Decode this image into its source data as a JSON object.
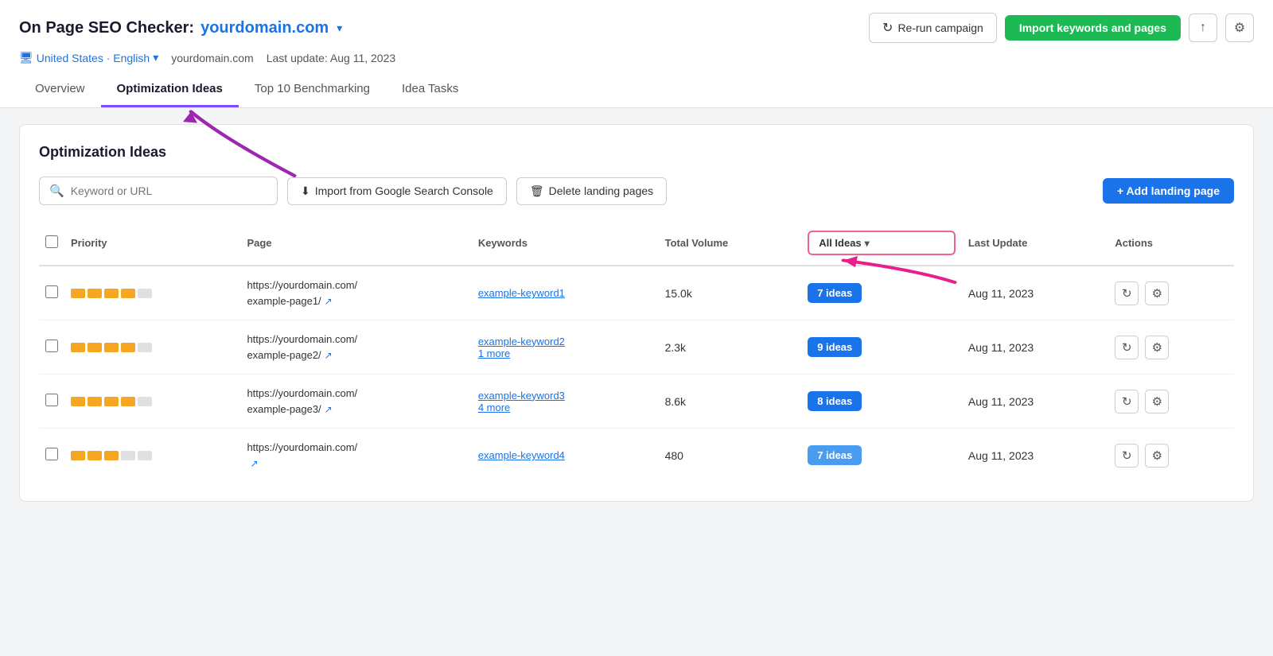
{
  "header": {
    "title_prefix": "On Page SEO Checker:",
    "domain": "yourdomain.com",
    "region": "United States · English",
    "domain_text": "yourdomain.com",
    "last_update": "Last update: Aug 11, 2023",
    "btn_rerun": "Re-run campaign",
    "btn_import": "Import keywords and pages"
  },
  "tabs": [
    {
      "id": "overview",
      "label": "Overview",
      "active": false
    },
    {
      "id": "optimization-ideas",
      "label": "Optimization Ideas",
      "active": true
    },
    {
      "id": "top10",
      "label": "Top 10 Benchmarking",
      "active": false
    },
    {
      "id": "idea-tasks",
      "label": "Idea Tasks",
      "active": false
    }
  ],
  "section": {
    "title": "Optimization Ideas",
    "search_placeholder": "Keyword or URL",
    "btn_gsc": "Import from Google Search Console",
    "btn_delete": "Delete landing pages",
    "btn_add": "+ Add landing page"
  },
  "table": {
    "columns": [
      "",
      "Priority",
      "Page",
      "Keywords",
      "Total Volume",
      "All Ideas",
      "Last Update",
      "Actions"
    ],
    "all_ideas_dropdown": "All Ideas",
    "rows": [
      {
        "priority_filled": 4,
        "priority_total": 5,
        "page": "https://yourdomain.com/\nexample-page1/",
        "keyword": "example-keyword1",
        "keyword_more": null,
        "volume": "15.0k",
        "ideas": "7 ideas",
        "ideas_color": "blue",
        "last_update": "Aug 11, 2023"
      },
      {
        "priority_filled": 4,
        "priority_total": 5,
        "page": "https://yourdomain.com/\nexample-page2/",
        "keyword": "example-keyword2",
        "keyword_more": "1 more",
        "volume": "2.3k",
        "ideas": "9 ideas",
        "ideas_color": "blue",
        "last_update": "Aug 11, 2023"
      },
      {
        "priority_filled": 4,
        "priority_total": 5,
        "page": "https://yourdomain.com/\nexample-page3/",
        "keyword": "example-keyword3",
        "keyword_more": "4 more",
        "volume": "8.6k",
        "ideas": "8 ideas",
        "ideas_color": "blue",
        "last_update": "Aug 11, 2023"
      },
      {
        "priority_filled": 3,
        "priority_total": 5,
        "page": "https://yourdomain.com/",
        "keyword": "example-keyword4",
        "keyword_more": null,
        "volume": "480",
        "ideas": "7 ideas",
        "ideas_color": "light-blue",
        "last_update": "Aug 11, 2023"
      }
    ]
  },
  "icons": {
    "search": "🔍",
    "rerun": "↻",
    "import_download": "⬇",
    "delete": "🗑",
    "share": "↑",
    "settings": "⚙",
    "external_link": "↗",
    "chevron_down": "▾",
    "monitor": "🖥"
  }
}
